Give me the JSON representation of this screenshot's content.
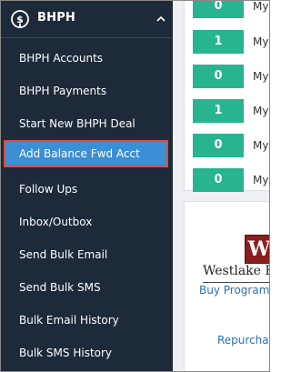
{
  "sidebar": {
    "title": "BHPH",
    "items": [
      {
        "label": "BHPH Accounts"
      },
      {
        "label": "BHPH Payments"
      },
      {
        "label": "Start New BHPH Deal"
      },
      {
        "label": "Add Balance Fwd Acct",
        "active": true
      },
      {
        "label": "Follow Ups"
      },
      {
        "label": "Inbox/Outbox"
      },
      {
        "label": "Send Bulk Email"
      },
      {
        "label": "Send Bulk SMS"
      },
      {
        "label": "Bulk Email History"
      },
      {
        "label": "Bulk SMS History"
      }
    ]
  },
  "stats": [
    {
      "value": "0",
      "label": "My A"
    },
    {
      "value": "1",
      "label": "My"
    },
    {
      "value": "0",
      "label": "My"
    },
    {
      "value": "1",
      "label": "My"
    },
    {
      "value": "0",
      "label": "My"
    },
    {
      "value": "0",
      "label": "My A"
    }
  ],
  "westlake": {
    "logo_letter": "W",
    "brand": "Westlake Fi",
    "link_program": "Buy Program",
    "link_repurchase": "Repurchas"
  },
  "colors": {
    "sidebar_bg": "#1d2a3a",
    "active_bg": "#3b8fd4",
    "active_border": "#e04a3f",
    "stat_green": "#27b48f",
    "link_blue": "#2a6fb7"
  }
}
